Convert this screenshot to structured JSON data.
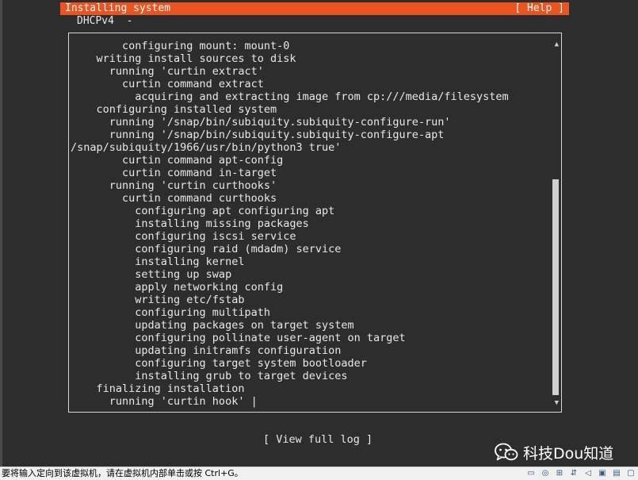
{
  "header": {
    "title": "Installing system",
    "help_label": "[ Help ]"
  },
  "network_status": "DHCPv4  -",
  "log": {
    "lines": [
      "        configuring mount: mount-0",
      "    writing install sources to disk",
      "      running 'curtin extract'",
      "        curtin command extract",
      "          acquiring and extracting image from cp:///media/filesystem",
      "    configuring installed system",
      "      running '/snap/bin/subiquity.subiquity-configure-run'",
      "      running '/snap/bin/subiquity.subiquity-configure-apt",
      "/snap/subiquity/1966/usr/bin/python3 true'",
      "        curtin command apt-config",
      "        curtin command in-target",
      "      running 'curtin curthooks'",
      "        curtin command curthooks",
      "          configuring apt configuring apt",
      "          installing missing packages",
      "          configuring iscsi service",
      "          configuring raid (mdadm) service",
      "          installing kernel",
      "          setting up swap",
      "          apply networking config",
      "          writing etc/fstab",
      "          configuring multipath",
      "          updating packages on target system",
      "          configuring pollinate user-agent on target",
      "          updating initramfs configuration",
      "          configuring target system bootloader",
      "          installing grub to target devices",
      "    finalizing installation",
      "      running 'curtin hook' |"
    ]
  },
  "view_log_label": "[ View full log ]",
  "watermark": {
    "text": "科技Dou知道",
    "icon": "wechat-icon"
  },
  "status_bar": {
    "text": "要将输入定向到该虚拟机，请在虚拟机内部单击或按 Ctrl+G。",
    "icons": [
      "hard-disk-icon",
      "cd-drive-icon",
      "network-icon",
      "usb-icon",
      "sound-icon",
      "display-icon",
      "printer-icon",
      "message-icon"
    ]
  },
  "colors": {
    "accent": "#e95420",
    "background": "#2d2d2d",
    "text": "#e8e8e8"
  }
}
